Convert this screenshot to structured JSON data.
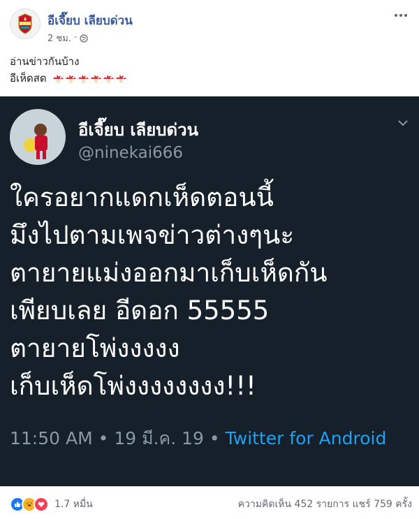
{
  "post": {
    "page_name": "อีเจี๊ยบ เลียบด่วน",
    "time": "2 ชม.",
    "separator": "·",
    "caption_line1": "อ่านข่าวกันบ้าง",
    "caption_line2": "อีเห็ดสด"
  },
  "tweet": {
    "name": "อีเจี๊ยบ เลียบด่วน",
    "handle": "@ninekai666",
    "text": "ใครอยากแดกเห็ดตอนนี้\nมึงไปตามเพจข่าวต่างๆนะ\nตายายแม่งออกมาเก็บเห็ดกัน\nเพียบเลย อีดอก 55555\nตายายโพ่งงงงง\nเก็บเห็ดโพ่งงงงงงงง!!!",
    "time": "11:50 AM",
    "dot": "•",
    "date": "19 มี.ค. 19",
    "source": "Twitter for Android"
  },
  "reactions": {
    "count": "1.7 หมื่น",
    "comments": "ความคิดเห็น 452 รายการ",
    "shares": "แชร์ 759 ครั้ง"
  },
  "colors": {
    "link_blue": "#385898",
    "tweet_bg": "#15202b",
    "twitter_blue": "#1da1f2"
  }
}
